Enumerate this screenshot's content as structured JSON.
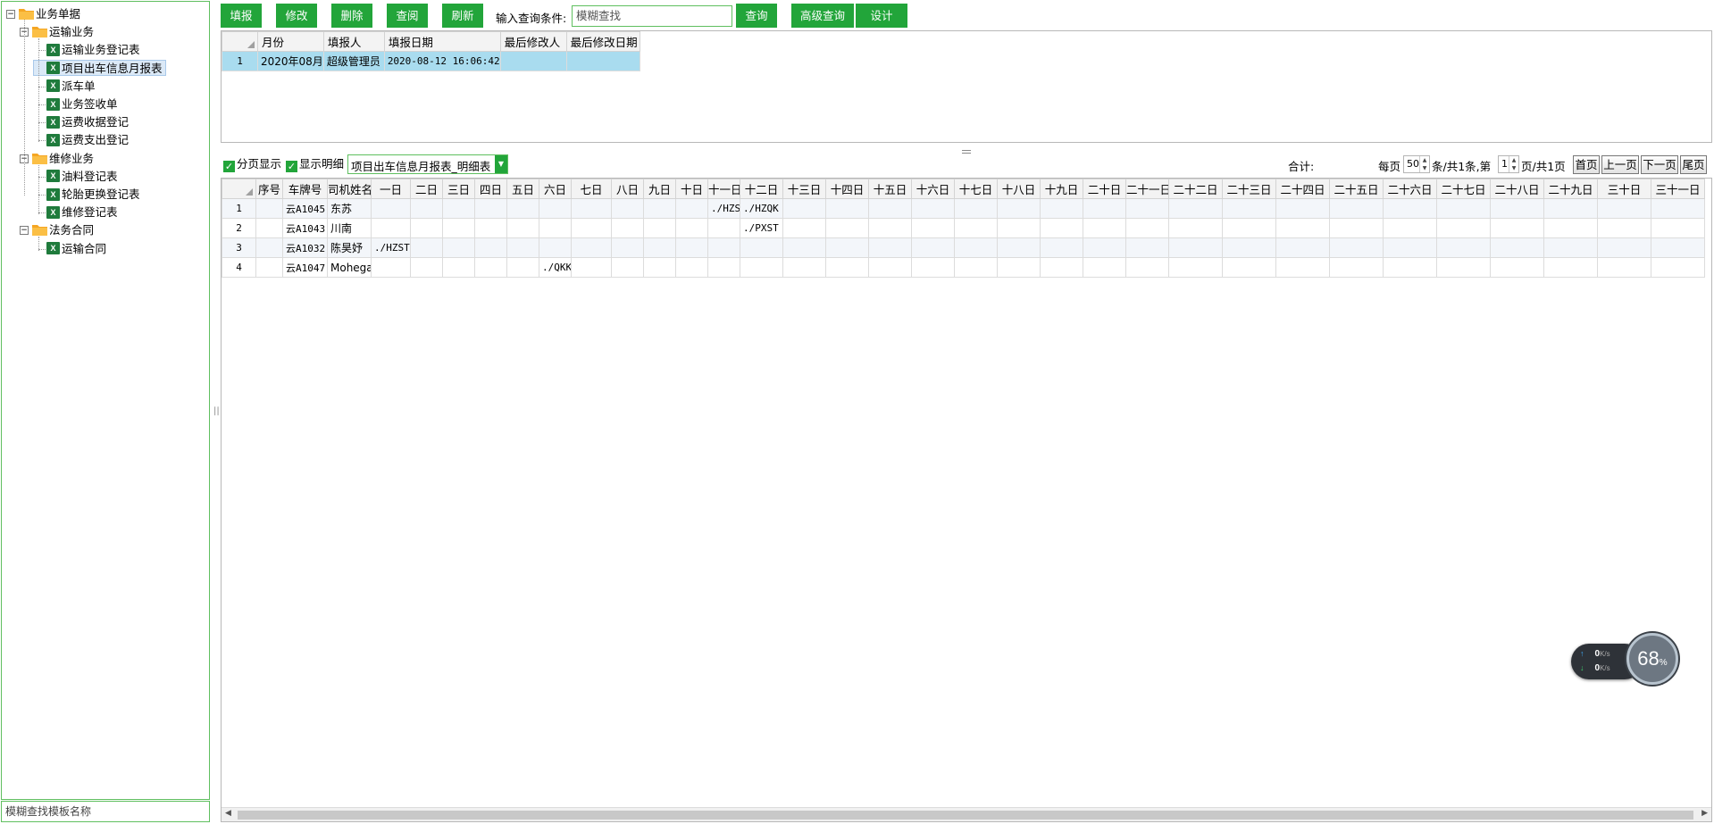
{
  "tree": {
    "root": "业务单据",
    "groups": [
      {
        "label": "运输业务",
        "items": [
          "运输业务登记表",
          "项目出车信息月报表",
          "派车单",
          "业务签收单",
          "运费收据登记",
          "运费支出登记"
        ]
      },
      {
        "label": "维修业务",
        "items": [
          "油料登记表",
          "轮胎更换登记表",
          "维修登记表"
        ]
      },
      {
        "label": "法务合同",
        "items": [
          "运输合同"
        ]
      }
    ],
    "selected": "项目出车信息月报表",
    "search_placeholder": "模糊查找模板名称",
    "xls_glyph": "X"
  },
  "toolbar": {
    "buttons": [
      "填报",
      "修改",
      "删除",
      "查阅",
      "刷新"
    ],
    "query_label": "输入查询条件:",
    "query_placeholder": "模糊查找",
    "query_button": "查询",
    "advanced_button": "高级查询",
    "design_button": "设计"
  },
  "top_grid": {
    "columns": [
      "月份",
      "填报人",
      "填报日期",
      "最后修改人",
      "最后修改日期"
    ],
    "rows": [
      {
        "num": "1",
        "month": "2020年08月",
        "reporter": "超级管理员",
        "date": "2020-08-12 16:06:42",
        "modifier": "",
        "mod_date": ""
      }
    ]
  },
  "toolbar2": {
    "paging_label": "分页显示",
    "detail_label": "显示明细",
    "detail_select_value": "项目出车信息月报表_明细表",
    "total_label": "合计:",
    "pager": {
      "per_page_label": "每页",
      "per_page": "50",
      "total_records": "条/共1条,第",
      "current_page": "1",
      "total_pages": "页/共1页",
      "first": "首页",
      "prev": "上一页",
      "next": "下一页",
      "last": "尾页"
    }
  },
  "bottom_grid": {
    "columns": [
      "序号",
      "车牌号",
      "司机姓名",
      "一日",
      "二日",
      "三日",
      "四日",
      "五日",
      "六日",
      "七日",
      "八日",
      "九日",
      "十日",
      "十一日",
      "十二日",
      "十三日",
      "十四日",
      "十五日",
      "十六日",
      "十七日",
      "十八日",
      "十九日",
      "二十日",
      "二十一日",
      "二十二日",
      "二十三日",
      "二十四日",
      "二十五日",
      "二十六日",
      "二十七日",
      "二十八日",
      "二十九日",
      "三十日",
      "三十一日"
    ],
    "rows": [
      {
        "num": "1",
        "seq": "",
        "plate": "云A1045",
        "driver": "东苏",
        "days": [
          "",
          "",
          "",
          "",
          "",
          "",
          "",
          "",
          "",
          "",
          "./HZST",
          "./HZQK",
          "",
          "",
          "",
          "",
          "",
          "",
          "",
          "",
          "",
          "",
          "",
          "",
          "",
          "",
          "",
          "",
          "",
          "",
          ""
        ]
      },
      {
        "num": "2",
        "seq": "",
        "plate": "云A1043",
        "driver": "川南",
        "days": [
          "",
          "",
          "",
          "",
          "",
          "",
          "",
          "",
          "",
          "",
          "",
          "./PXST",
          "",
          "",
          "",
          "",
          "",
          "",
          "",
          "",
          "",
          "",
          "",
          "",
          "",
          "",
          "",
          "",
          "",
          "",
          ""
        ]
      },
      {
        "num": "3",
        "seq": "",
        "plate": "云A1032",
        "driver": "陈昊妤",
        "days": [
          "./HZST",
          "",
          "",
          "",
          "",
          "",
          "",
          "",
          "",
          "",
          "",
          "",
          "",
          "",
          "",
          "",
          "",
          "",
          "",
          "",
          "",
          "",
          "",
          "",
          "",
          "",
          "",
          "",
          "",
          "",
          ""
        ]
      },
      {
        "num": "4",
        "seq": "",
        "plate": "云A1047",
        "driver": "Mohegan",
        "days": [
          "",
          "",
          "",
          "",
          "",
          "./QKKB",
          "",
          "",
          "",
          "",
          "",
          "",
          "",
          "",
          "",
          "",
          "",
          "",
          "",
          "",
          "",
          "",
          "",
          "",
          "",
          "",
          "",
          "",
          "",
          "",
          ""
        ]
      }
    ]
  },
  "speed_widget": {
    "up": "0",
    "down": "0",
    "unit": "K/s",
    "percent": "68",
    "percent_sign": "%"
  },
  "colors": {
    "accent_green": "#22a53a",
    "selected_row": "#a9dcef",
    "folder": "#f5a623"
  }
}
